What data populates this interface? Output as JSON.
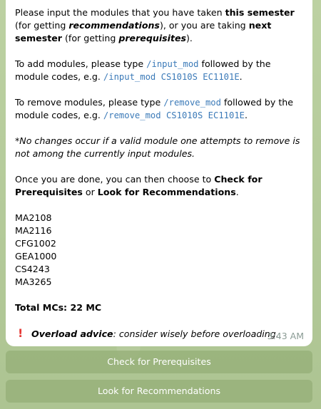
{
  "message": {
    "intro_1": "Please input the modules that you have taken ",
    "intro_this_semester": "this semester",
    "intro_2": " (for getting ",
    "intro_recommendations": "recommendations",
    "intro_3": "), or you are taking ",
    "intro_next_semester": "next semester",
    "intro_4": " (for getting ",
    "intro_prerequisites": "prerequisites",
    "intro_5": ").",
    "add_1": "To add modules, please type ",
    "add_cmd": "/input_mod",
    "add_2": " followed by the module codes, e.g. ",
    "add_example": "/input_mod CS1010S EC1101E",
    "add_3": ".",
    "remove_1": "To remove modules, please type ",
    "remove_cmd": "/remove_mod",
    "remove_2": " followed by the module codes, e.g. ",
    "remove_example": "/remove_mod CS1010S EC1101E",
    "remove_3": ".",
    "note_star": "*",
    "note_text": "No changes occur if a valid module one attempts to remove is not among the currently input modules.",
    "done_1": "Once you are done, you can then choose to ",
    "done_check": "Check for Prerequisites",
    "done_or": " or ",
    "done_look": "Look for Recommendations",
    "done_end": ".",
    "modules": [
      "MA2108",
      "MA2116",
      "CFG1002",
      "GEA1000",
      "CS4243",
      "MA3265"
    ],
    "total": "Total MCs: 22 MC",
    "advice_icon": "!",
    "advice_label": "Overload advice",
    "advice_text": ": consider wisely before overloading.",
    "time": "3:43 AM"
  },
  "keyboard": {
    "check_label": "Check for Prerequisites",
    "look_label": "Look for Recommendations"
  },
  "colors": {
    "code": "#3b7ab8",
    "alert": "#e53935",
    "button_bg": "#96af78",
    "bubble_bg": "#ffffff"
  }
}
